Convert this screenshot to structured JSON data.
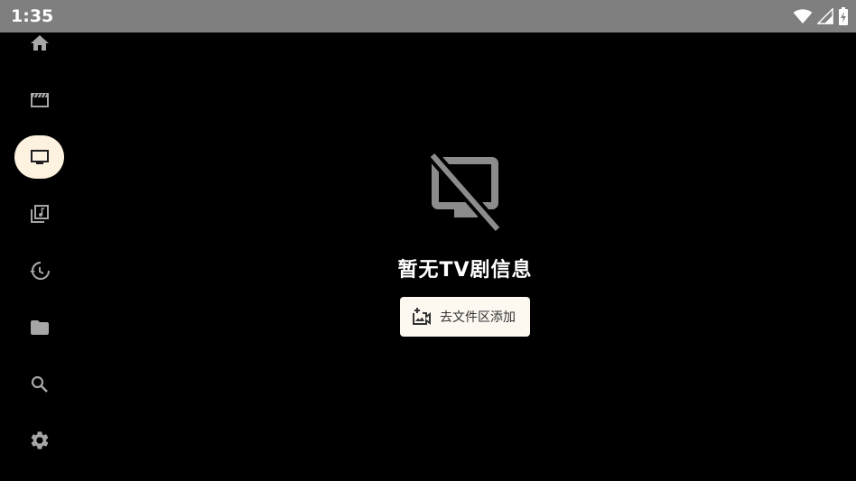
{
  "status_bar": {
    "time": "1:35",
    "icons": [
      "wifi-icon",
      "signal-icon",
      "battery-charging-icon"
    ]
  },
  "nav_rail": {
    "items": [
      {
        "name": "home",
        "icon": "home-icon",
        "active": false
      },
      {
        "name": "movies",
        "icon": "movie-icon",
        "active": false
      },
      {
        "name": "tv",
        "icon": "tv-icon",
        "active": true
      },
      {
        "name": "music",
        "icon": "music-library-icon",
        "active": false
      },
      {
        "name": "history",
        "icon": "history-icon",
        "active": false
      },
      {
        "name": "folder",
        "icon": "folder-icon",
        "active": false
      },
      {
        "name": "search",
        "icon": "search-icon",
        "active": false
      },
      {
        "name": "settings",
        "icon": "gear-icon",
        "active": false
      }
    ]
  },
  "empty_state": {
    "icon": "tv-off-icon",
    "title": "暂无TV剧信息",
    "button_icon": "add-video-icon",
    "button_label": "去文件区添加"
  },
  "colors": {
    "background": "#000000",
    "status_bar": "#7f7f7f",
    "nav_icon": "#a6a6a6",
    "active_pill": "#fdf2e0",
    "button_bg": "#fdf8f0"
  }
}
